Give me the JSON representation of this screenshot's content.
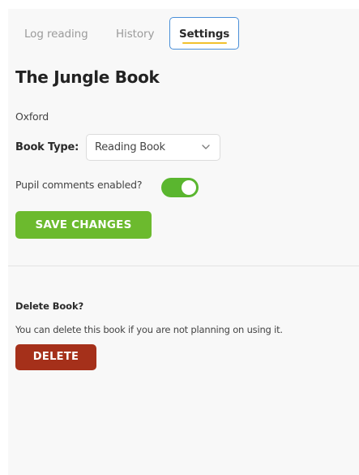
{
  "tabs": {
    "log_reading": "Log reading",
    "history": "History",
    "settings": "Settings",
    "active": "Settings"
  },
  "book": {
    "title": "The Jungle Book",
    "publisher": "Oxford"
  },
  "book_type": {
    "label": "Book Type:",
    "selected": "Reading Book"
  },
  "pupil_comments": {
    "label": "Pupil comments enabled?",
    "enabled": true
  },
  "save_button": {
    "label": "SAVE CHANGES"
  },
  "delete_section": {
    "heading": "Delete Book?",
    "description": "You can delete this book if you are not planning on using it.",
    "button_label": "DELETE"
  },
  "icons": {
    "select_chevron": "chevron-down-icon"
  },
  "colors": {
    "active_tab_border": "#4a8fd8",
    "active_tab_underline": "#f2c12e",
    "toggle_on": "#5ab62f",
    "save_button": "#6cba2e",
    "delete_button": "#a5301a"
  }
}
